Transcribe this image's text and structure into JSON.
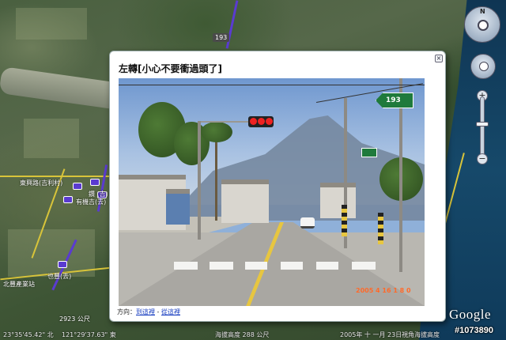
{
  "map": {
    "route_badge": "193",
    "labels": [
      {
        "text": "東興路(吉利村)",
        "name": "map-label-place-1"
      },
      {
        "text": "鑽 (吉)",
        "name": "map-label-place-2"
      },
      {
        "text": "有機吉(去)",
        "name": "map-label-place-3"
      },
      {
        "text": "也豐(去)",
        "name": "map-label-place-4"
      },
      {
        "text": "北豐產業站",
        "name": "map-label-place-5"
      }
    ],
    "scale_text": "2923 公尺"
  },
  "balloon": {
    "title": "左轉[小心不要衝過頭了]",
    "close_symbol": "×",
    "direction_label": "方向：",
    "link_1": "到這裡",
    "separator": " - ",
    "link_2": "從這裡"
  },
  "photo": {
    "sign_text": "193",
    "timestamp": "2005 4 16 1 8 0"
  },
  "status": {
    "lat": "23°35'45.42\" 北",
    "lon": "121°29'37.63\" 東",
    "elevation": "海拔高度 288 公尺",
    "date_text": "2005年 十 一月 23日",
    "eye_alt": "視角海拔高度"
  },
  "nav": {
    "north_label": "N",
    "zoom_in": "+",
    "zoom_out": "−"
  },
  "branding": {
    "logo": "Google",
    "image_id": "#1073890"
  }
}
